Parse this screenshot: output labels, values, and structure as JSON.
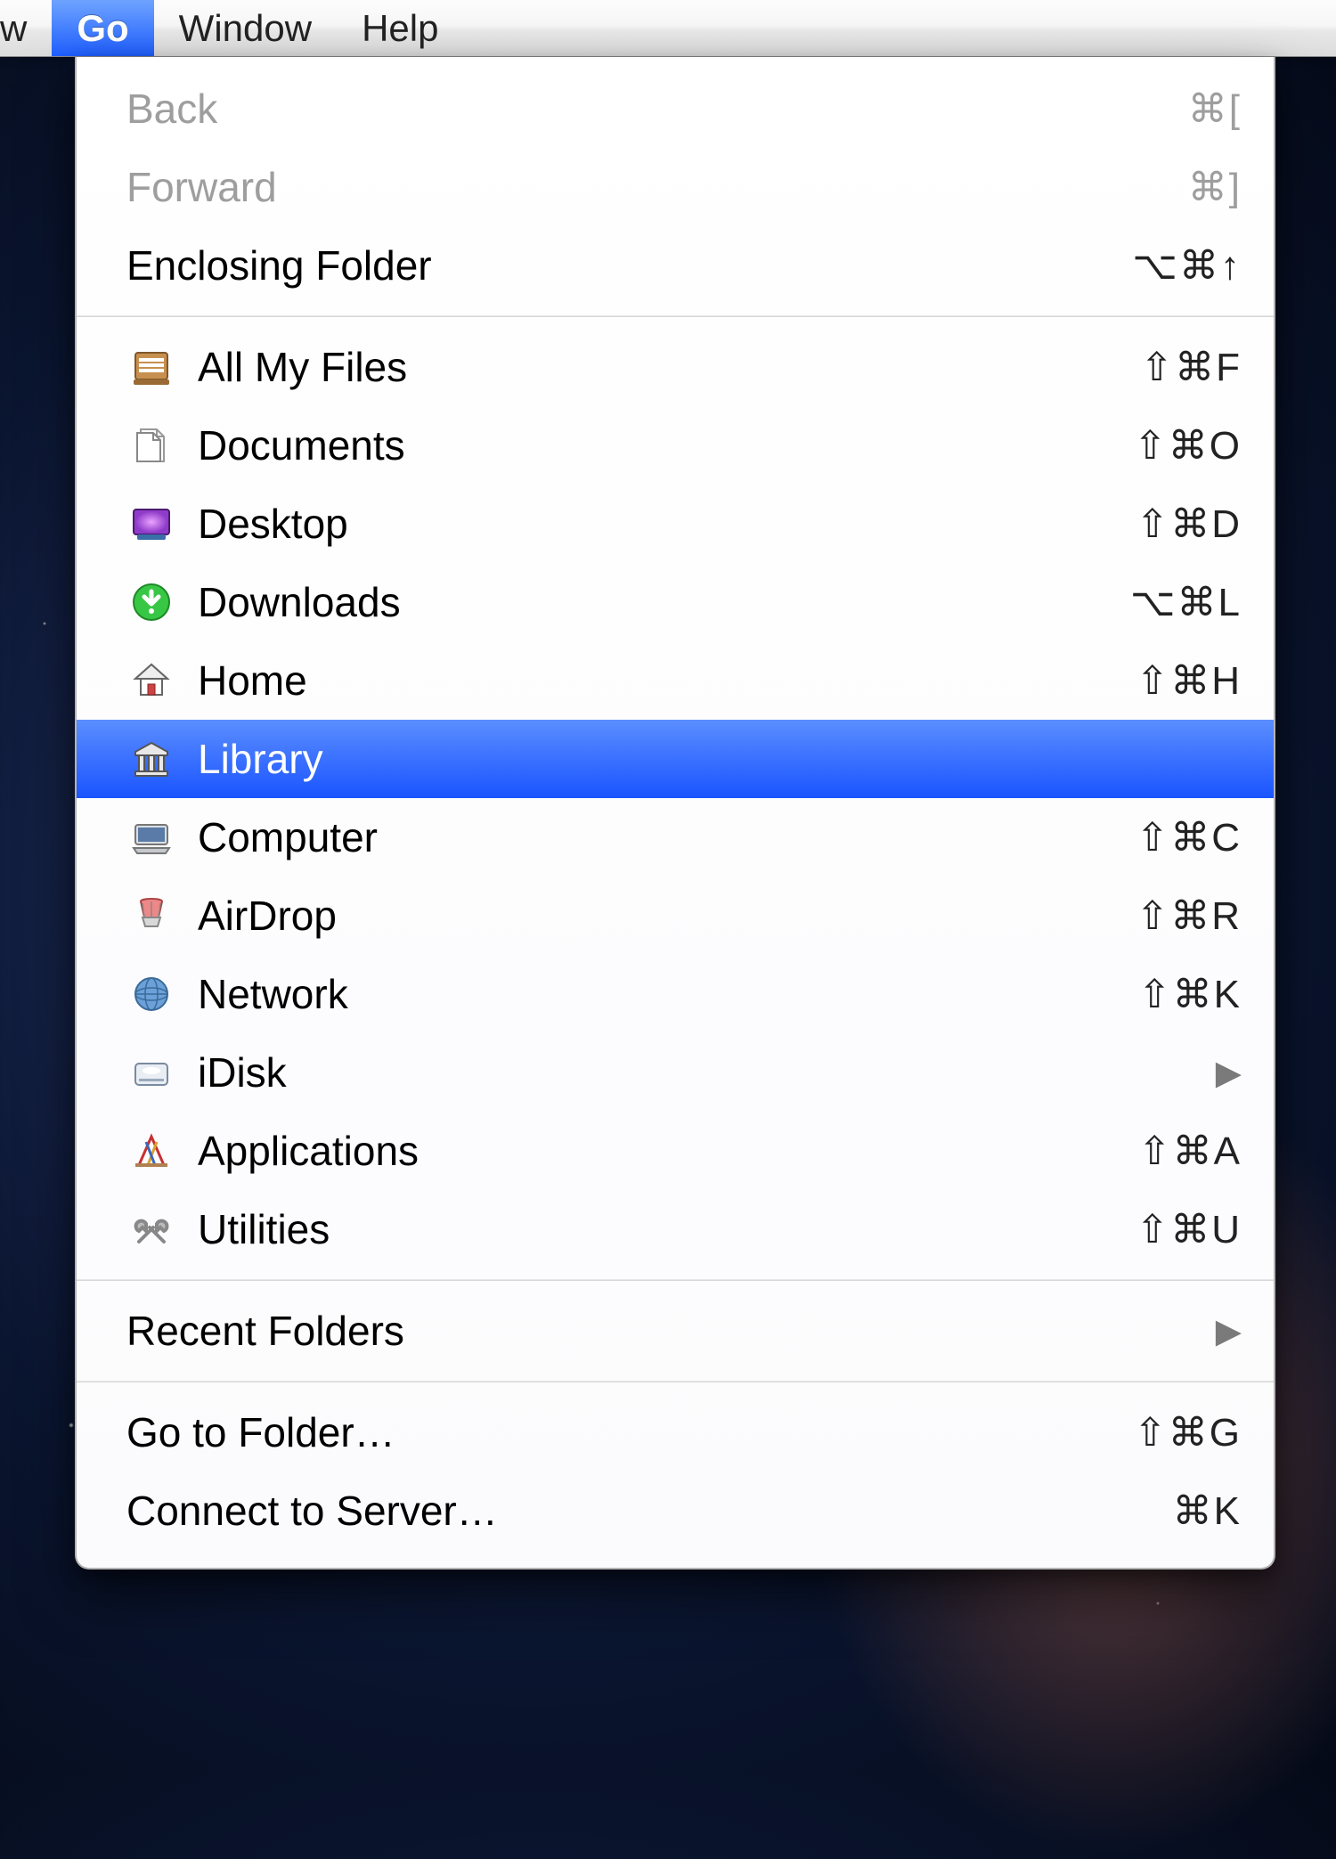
{
  "menubar": {
    "items": [
      {
        "label": "w",
        "partial": true
      },
      {
        "label": "Go",
        "selected": true
      },
      {
        "label": "Window"
      },
      {
        "label": "Help"
      }
    ]
  },
  "menu": {
    "groups": [
      {
        "kind": "nav",
        "items": [
          {
            "name": "back",
            "label": "Back",
            "shortcut": "⌘[",
            "disabled": true
          },
          {
            "name": "forward",
            "label": "Forward",
            "shortcut": "⌘]",
            "disabled": true
          },
          {
            "name": "enclosing-folder",
            "label": "Enclosing Folder",
            "shortcut": "⌥⌘↑"
          }
        ]
      },
      {
        "kind": "places",
        "items": [
          {
            "name": "all-my-files",
            "icon": "all-my-files-icon",
            "label": "All My Files",
            "shortcut": "⇧⌘F"
          },
          {
            "name": "documents",
            "icon": "documents-icon",
            "label": "Documents",
            "shortcut": "⇧⌘O"
          },
          {
            "name": "desktop",
            "icon": "desktop-icon",
            "label": "Desktop",
            "shortcut": "⇧⌘D"
          },
          {
            "name": "downloads",
            "icon": "downloads-icon",
            "label": "Downloads",
            "shortcut": "⌥⌘L"
          },
          {
            "name": "home",
            "icon": "home-icon",
            "label": "Home",
            "shortcut": "⇧⌘H"
          },
          {
            "name": "library",
            "icon": "library-icon",
            "label": "Library",
            "shortcut": "",
            "highlight": true
          },
          {
            "name": "computer",
            "icon": "computer-icon",
            "label": "Computer",
            "shortcut": "⇧⌘C"
          },
          {
            "name": "airdrop",
            "icon": "airdrop-icon",
            "label": "AirDrop",
            "shortcut": "⇧⌘R"
          },
          {
            "name": "network",
            "icon": "network-icon",
            "label": "Network",
            "shortcut": "⇧⌘K"
          },
          {
            "name": "idisk",
            "icon": "idisk-icon",
            "label": "iDisk",
            "submenu": true
          },
          {
            "name": "applications",
            "icon": "applications-icon",
            "label": "Applications",
            "shortcut": "⇧⌘A"
          },
          {
            "name": "utilities",
            "icon": "utilities-icon",
            "label": "Utilities",
            "shortcut": "⇧⌘U"
          }
        ]
      },
      {
        "kind": "recent",
        "items": [
          {
            "name": "recent-folders",
            "label": "Recent Folders",
            "submenu": true
          }
        ]
      },
      {
        "kind": "connect",
        "items": [
          {
            "name": "go-to-folder",
            "label": "Go to Folder…",
            "shortcut": "⇧⌘G"
          },
          {
            "name": "connect-to-server",
            "label": "Connect to Server…",
            "shortcut": "⌘K"
          }
        ]
      }
    ]
  }
}
